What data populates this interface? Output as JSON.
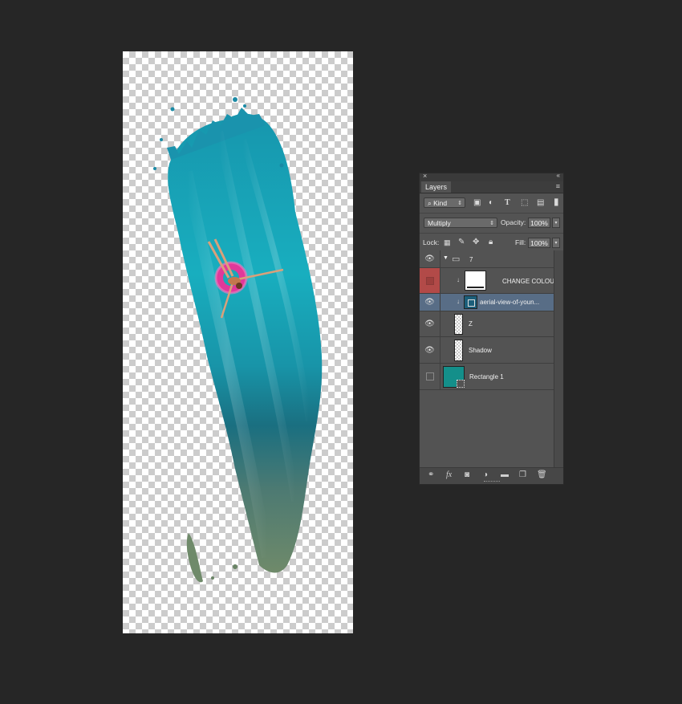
{
  "panel": {
    "title": "Layers",
    "filter_kind": "Kind",
    "blend_mode": "Multiply",
    "opacity_label": "Opacity:",
    "opacity_value": "100%",
    "lock_label": "Lock:",
    "fill_label": "Fill:",
    "fill_value": "100%"
  },
  "layers": [
    {
      "name": "7",
      "type": "group",
      "visible": true
    },
    {
      "name": "CHANGE COLOUR",
      "type": "adjustment",
      "visible": false,
      "color_tag": "#b24a48"
    },
    {
      "name": "aerial-view-of-youn...",
      "type": "smart-object",
      "visible": true,
      "selected": true
    },
    {
      "name": "Z",
      "type": "pixel",
      "visible": true
    },
    {
      "name": "Shadow",
      "type": "pixel",
      "visible": true
    },
    {
      "name": "Rectangle 1",
      "type": "shape",
      "visible": false,
      "swatch": "#148f8a"
    }
  ],
  "colors": {
    "background": "#262626",
    "panel": "#535353",
    "selected_row": "#586d86",
    "brush_teal": "#1aa7b7",
    "float_pink": "#e0399a"
  },
  "icons": {
    "close": "close-icon",
    "collapse": "double-chevron-icon",
    "panel_menu": "panel-menu-icon",
    "eye": "eye-icon",
    "folder": "folder-icon"
  }
}
